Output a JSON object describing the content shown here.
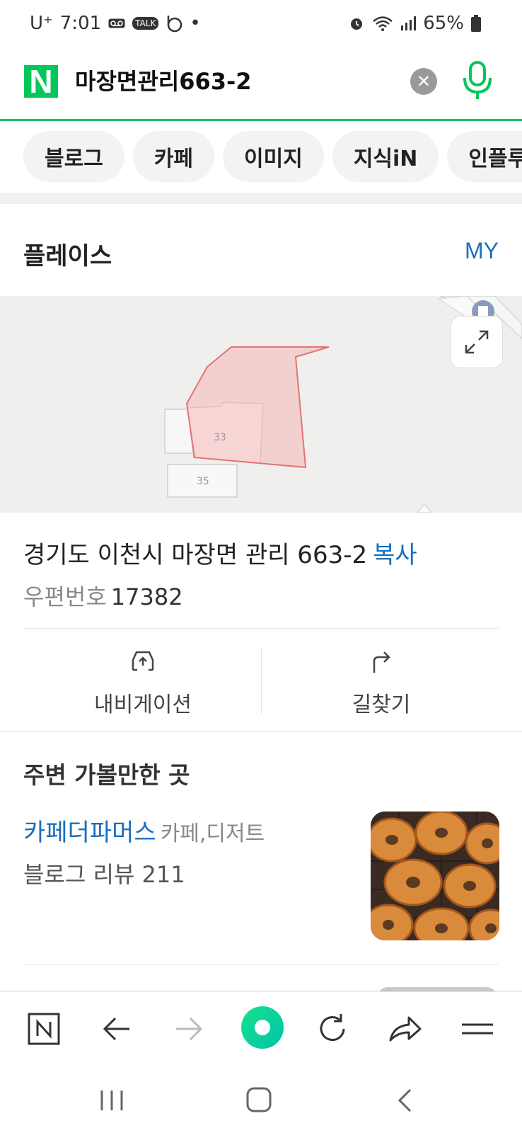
{
  "status_bar": {
    "carrier": "U⁺",
    "time": "7:01",
    "talk_badge": "TALK",
    "dot": "•",
    "battery": "65%"
  },
  "search": {
    "logo": "N",
    "query": "마장면관리663-2",
    "clear": "✕"
  },
  "tabs": [
    "블로그",
    "카페",
    "이미지",
    "지식iN",
    "인플루"
  ],
  "place": {
    "title": "플레이스",
    "my_link": "MY",
    "map_labels": [
      "33",
      "35"
    ],
    "address": "경기도 이천시 마장면 관리 663-2",
    "copy_label": "복사",
    "postal_label": "우편번호",
    "postal_code": "17382",
    "actions": [
      {
        "label": "내비게이션",
        "icon": "car-navigation-icon"
      },
      {
        "label": "길찾기",
        "icon": "directions-arrow-icon"
      }
    ]
  },
  "nearby": {
    "title": "주변 가볼만한 곳",
    "items": [
      {
        "name": "카페더파머스",
        "category": "카페,디저트",
        "review": "블로그 리뷰 211"
      }
    ]
  },
  "toolbar": [
    "naver-home-icon",
    "back-arrow-icon",
    "forward-arrow-icon",
    "green-dot-icon",
    "refresh-icon",
    "share-icon",
    "menu-icon"
  ],
  "colors": {
    "brand_green": "#03c75a",
    "link_blue": "#1a6fbf",
    "parcel_fill": "#f4b6b6"
  }
}
